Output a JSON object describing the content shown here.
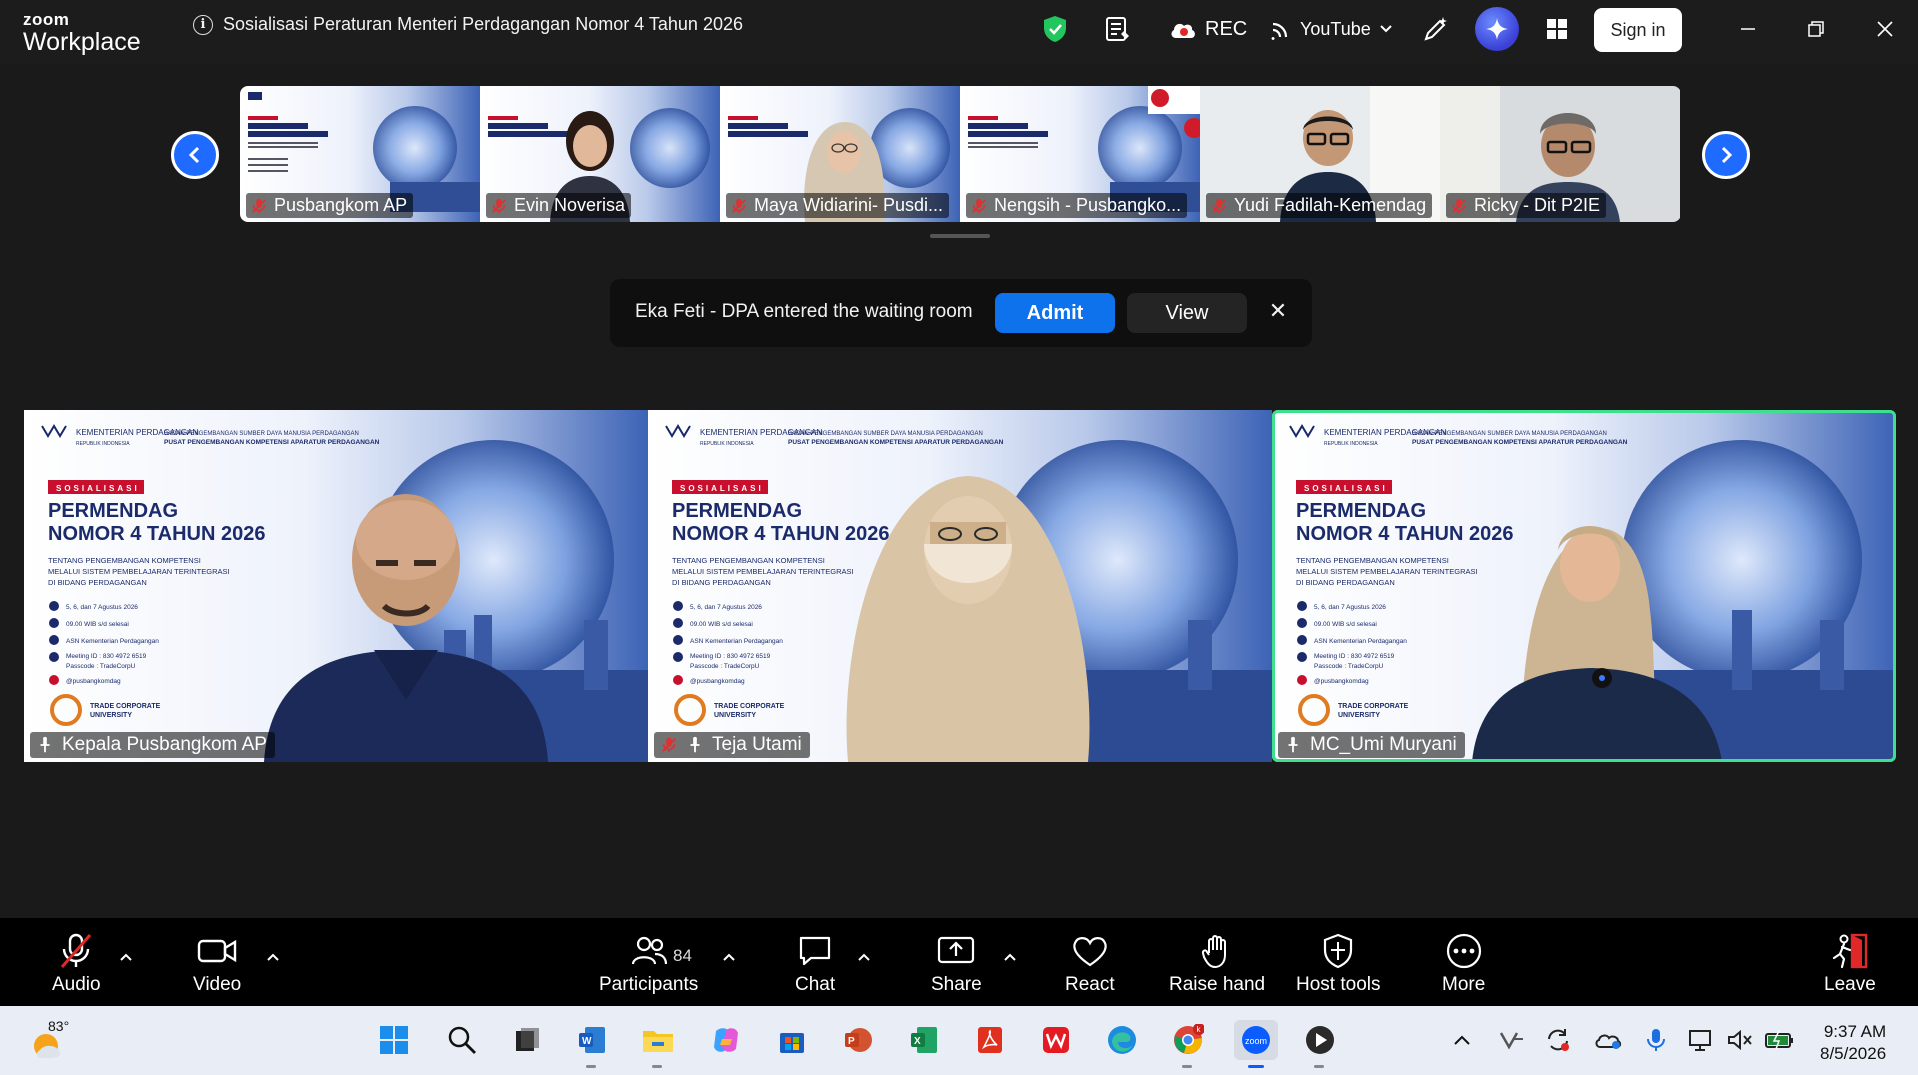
{
  "app": {
    "brand_top": "zoom",
    "brand_bottom": "Workplace",
    "meeting_title": "Sosialisasi Peraturan Menteri Perdagangan Nomor 4 Tahun 2026",
    "rec_label": "REC",
    "stream_label": "YouTube",
    "signin_label": "Sign in"
  },
  "gallery": [
    {
      "name": "Pusbangkom AP"
    },
    {
      "name": "Evin Noverisa"
    },
    {
      "name": "Maya Widiarini- Pusdi..."
    },
    {
      "name": "Nengsih - Pusbangko..."
    },
    {
      "name": "Yudi Fadilah-Kemendag"
    },
    {
      "name": "Ricky - Dit P2IE"
    }
  ],
  "waiting_room": {
    "message": "Eka Feti - DPA entered the waiting room",
    "admit_label": "Admit",
    "view_label": "View"
  },
  "slide": {
    "ministry": "KEMENTERIAN PERDAGANGAN",
    "republic": "REPUBLIK INDONESIA",
    "agency_1": "BADAN PENGEMBANGAN SUMBER DAYA MANUSIA PERDAGANGAN",
    "agency_2": "PUSAT PENGEMBANGAN KOMPETENSI APARATUR PERDAGANGAN",
    "tag": "SOSIALISASI",
    "title_1": "PERMENDAG",
    "title_2": "NOMOR 4 TAHUN 2026",
    "subtitle_1": "TENTANG PENGEMBANGAN KOMPETENSI",
    "subtitle_2": "MELALUI SISTEM PEMBELAJARAN TERINTEGRASI",
    "subtitle_3": "DI BIDANG PERDAGANGAN",
    "date": "5, 6, dan 7 Agustus 2026",
    "time": "09.00 WIB s/d selesai",
    "audience": "ASN Kementerian Perdagangan",
    "meeting_id": "Meeting ID : 830 4972 6519",
    "passcode": "Passcode : TradeCorpU",
    "social": "@pusbangkomdag",
    "tcu_1": "TRADE CORPORATE",
    "tcu_2": "UNIVERSITY"
  },
  "main_tiles": [
    {
      "name": "Kepala Pusbangkom AP",
      "active": false,
      "muted": false
    },
    {
      "name": "Teja Utami",
      "active": false,
      "muted": true
    },
    {
      "name": "MC_Umi Muryani",
      "active": true,
      "muted": false
    }
  ],
  "toolbar": {
    "audio": "Audio",
    "video": "Video",
    "participants": "Participants",
    "participant_count": "84",
    "chat": "Chat",
    "share": "Share",
    "react": "React",
    "raise_hand": "Raise hand",
    "host_tools": "Host tools",
    "more": "More",
    "leave": "Leave"
  },
  "taskbar": {
    "temperature": "83°",
    "time": "9:37 AM",
    "date": "8/5/2026"
  },
  "colors": {
    "accent_blue": "#0e72ed",
    "active_speaker": "#3ee08e",
    "slide_navy": "#1b2a6b",
    "slide_red": "#c8102e"
  }
}
